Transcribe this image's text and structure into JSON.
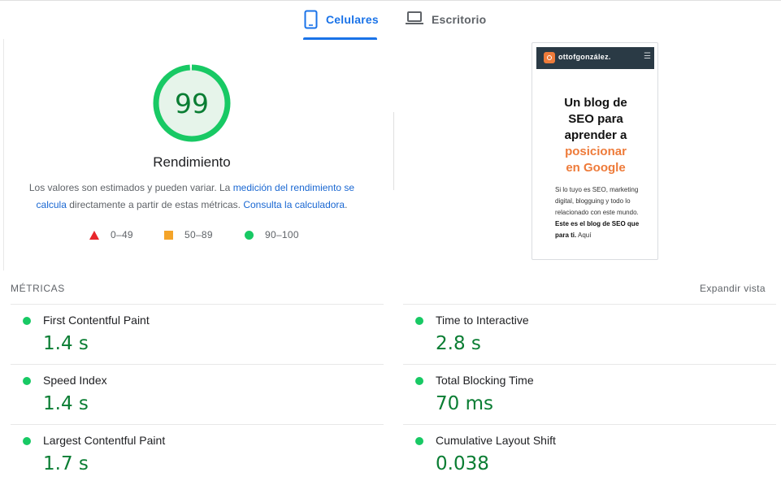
{
  "tabs": [
    {
      "label": "Celulares",
      "icon": "smartphone-icon",
      "active": true
    },
    {
      "label": "Escritorio",
      "icon": "laptop-icon",
      "active": false
    }
  ],
  "score": {
    "value": "99",
    "fraction": 0.99,
    "title": "Rendimiento",
    "color": "#0a7d33",
    "ring_color": "#18c964",
    "ring_bg": "#e6f4ea"
  },
  "description": {
    "part1": "Los valores son estimados y pueden variar. La ",
    "link1": "medición del rendimiento se calcula",
    "part2": " directamente a partir de estas métricas. ",
    "link2": "Consulta la calculadora",
    "part3": "."
  },
  "legend": [
    {
      "range": "0–49",
      "shape": "triangle",
      "color": "#e8262b"
    },
    {
      "range": "50–89",
      "shape": "square",
      "color": "#f4a429"
    },
    {
      "range": "90–100",
      "shape": "circle",
      "color": "#18c964"
    }
  ],
  "screenshot": {
    "brand": "ottofgonzález.",
    "heading_line1": "Un blog de",
    "heading_line2": "SEO para",
    "heading_line3": "aprender a",
    "heading_orange1": "posicionar",
    "heading_orange2": "en Google",
    "body1": "Si lo tuyo es SEO, marketing digital, blogguing y todo lo relacionado con este mundo. ",
    "body_bold": "Este es el blog de SEO que para ti.",
    "body2": " Aquí"
  },
  "metrics": {
    "title": "MÉTRICAS",
    "expand_label": "Expandir vista",
    "items": [
      {
        "name": "First Contentful Paint",
        "value": "1.4 s"
      },
      {
        "name": "Time to Interactive",
        "value": "2.8 s"
      },
      {
        "name": "Speed Index",
        "value": "1.4 s"
      },
      {
        "name": "Total Blocking Time",
        "value": "70 ms"
      },
      {
        "name": "Largest Contentful Paint",
        "value": "1.7 s"
      },
      {
        "name": "Cumulative Layout Shift",
        "value": "0.038"
      }
    ]
  }
}
